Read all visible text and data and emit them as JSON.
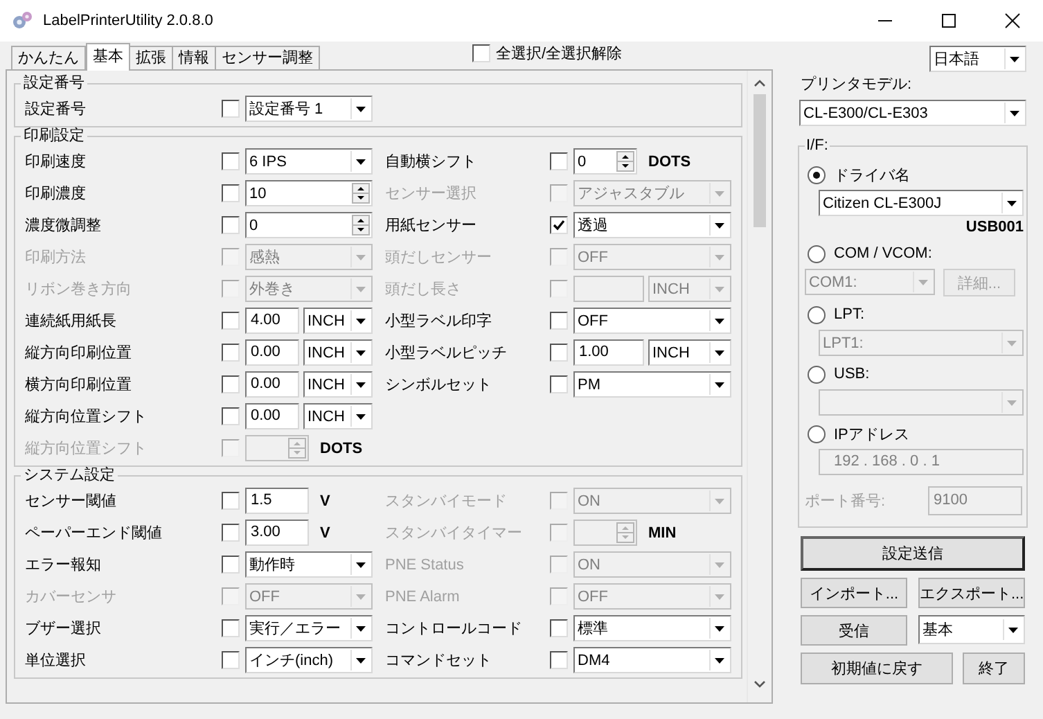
{
  "window": {
    "title": "LabelPrinterUtility 2.0.8.0"
  },
  "tabs": [
    {
      "label": "かんたん",
      "selected": false
    },
    {
      "label": "基本",
      "selected": true
    },
    {
      "label": "拡張",
      "selected": false
    },
    {
      "label": "情報",
      "selected": false
    },
    {
      "label": "センサー調整",
      "selected": false
    }
  ],
  "select_all": {
    "label": "全選択/全選択解除",
    "checked": false
  },
  "language": {
    "value": "日本語"
  },
  "sections": [
    {
      "title": "設定番号",
      "left": [
        {
          "label": "設定番号",
          "checked": false,
          "disabled": false,
          "kind": "select",
          "value": "設定番号 1"
        }
      ]
    },
    {
      "title": "印刷設定",
      "left": [
        {
          "label": "印刷速度",
          "checked": false,
          "disabled": false,
          "kind": "select",
          "value": "6 IPS"
        },
        {
          "label": "印刷濃度",
          "checked": false,
          "disabled": false,
          "kind": "spin",
          "value": "10"
        },
        {
          "label": "濃度微調整",
          "checked": false,
          "disabled": false,
          "kind": "spin",
          "value": "0"
        },
        {
          "label": "印刷方法",
          "checked": false,
          "disabled": true,
          "kind": "select",
          "value": "感熱"
        },
        {
          "label": "リボン巻き方向",
          "checked": false,
          "disabled": true,
          "kind": "select",
          "value": "外巻き"
        },
        {
          "label": "連続紙用紙長",
          "checked": false,
          "disabled": false,
          "kind": "input_select",
          "value": "4.00",
          "unit": "INCH"
        },
        {
          "label": "縦方向印刷位置",
          "checked": false,
          "disabled": false,
          "kind": "input_select",
          "value": "0.00",
          "unit": "INCH"
        },
        {
          "label": "横方向印刷位置",
          "checked": false,
          "disabled": false,
          "kind": "input_select",
          "value": "0.00",
          "unit": "INCH"
        },
        {
          "label": "縦方向位置シフト",
          "checked": false,
          "disabled": false,
          "kind": "input_select",
          "value": "0.00",
          "unit": "INCH"
        },
        {
          "label": "縦方向位置シフト",
          "checked": false,
          "disabled": true,
          "kind": "spin",
          "unit": "DOTS"
        }
      ],
      "right": [
        {
          "label": "自動横シフト",
          "checked": false,
          "disabled": false,
          "kind": "spin",
          "value": "0",
          "unit": "DOTS"
        },
        {
          "label": "センサー選択",
          "checked": false,
          "disabled": true,
          "kind": "select",
          "value": "アジャスタブル"
        },
        {
          "label": "用紙センサー",
          "checked": true,
          "disabled": false,
          "kind": "select",
          "value": "透過"
        },
        {
          "label": "頭だしセンサー",
          "checked": false,
          "disabled": true,
          "kind": "select",
          "value": "OFF"
        },
        {
          "label": "頭だし長さ",
          "checked": false,
          "disabled": true,
          "kind": "input_select",
          "unit": "INCH"
        },
        {
          "label": "小型ラベル印字",
          "checked": false,
          "disabled": false,
          "kind": "select",
          "value": "OFF"
        },
        {
          "label": "小型ラベルピッチ",
          "checked": false,
          "disabled": false,
          "kind": "input_select",
          "value": "1.00",
          "unit": "INCH"
        },
        {
          "label": "シンボルセット",
          "checked": false,
          "disabled": false,
          "kind": "select",
          "value": "PM"
        }
      ]
    },
    {
      "title": "システム設定",
      "left": [
        {
          "label": "センサー閾値",
          "checked": false,
          "disabled": false,
          "kind": "input",
          "value": "1.5",
          "unit": "V"
        },
        {
          "label": "ペーパーエンド閾値",
          "checked": false,
          "disabled": false,
          "kind": "input",
          "value": "3.00",
          "unit": "V"
        },
        {
          "label": "エラー報知",
          "checked": false,
          "disabled": false,
          "kind": "select",
          "value": "動作時"
        },
        {
          "label": "カバーセンサ",
          "checked": false,
          "disabled": true,
          "kind": "select",
          "value": "OFF"
        },
        {
          "label": "ブザー選択",
          "checked": false,
          "disabled": false,
          "kind": "select",
          "value": "実行／エラー"
        },
        {
          "label": "単位選択",
          "checked": false,
          "disabled": false,
          "kind": "select",
          "value": "インチ(inch)"
        }
      ],
      "right": [
        {
          "label": "スタンバイモード",
          "checked": false,
          "disabled": true,
          "kind": "select",
          "value": "ON"
        },
        {
          "label": "スタンバイタイマー",
          "checked": false,
          "disabled": true,
          "kind": "spin",
          "unit": "MIN"
        },
        {
          "label": "PNE Status",
          "checked": false,
          "disabled": true,
          "kind": "select",
          "value": "ON"
        },
        {
          "label": "PNE Alarm",
          "checked": false,
          "disabled": true,
          "kind": "select",
          "value": "OFF"
        },
        {
          "label": "コントロールコード",
          "checked": false,
          "disabled": false,
          "kind": "select",
          "value": "標準"
        },
        {
          "label": "コマンドセット",
          "checked": false,
          "disabled": false,
          "kind": "select",
          "value": "DM4"
        }
      ]
    }
  ],
  "printer_model": {
    "label": "プリンタモデル:",
    "value": "CL-E300/CL-E303"
  },
  "interface": {
    "title": "I/F:",
    "options": [
      {
        "kind": "driver",
        "label": "ドライバ名",
        "selected": true,
        "disabled": false,
        "value": "Citizen CL-E300J",
        "port": "USB001"
      },
      {
        "kind": "com",
        "label": "COM / VCOM:",
        "selected": false,
        "disabled": true,
        "value": "COM1:",
        "button": "詳細..."
      },
      {
        "kind": "select",
        "label": "LPT:",
        "selected": false,
        "disabled": true,
        "value": "LPT1:"
      },
      {
        "kind": "select",
        "label": "USB:",
        "selected": false,
        "disabled": true
      },
      {
        "kind": "ip",
        "label": "IPアドレス",
        "selected": false,
        "disabled": true,
        "address": "192 . 168 . 0 . 1",
        "port_label": "ポート番号:",
        "port": "9100"
      }
    ]
  },
  "actions": {
    "send": "設定送信",
    "import": "インポート...",
    "export": "エクスポート...",
    "receive": "受信",
    "receive_mode": "基本",
    "reset": "初期値に戻す",
    "exit": "終了"
  }
}
